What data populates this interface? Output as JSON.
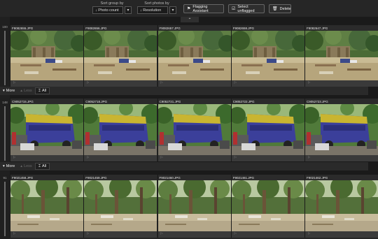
{
  "toolbar": {
    "sort_group_label": "Sort group by",
    "sort_group_value": "↓ Photo count",
    "sort_photos_label": "Sort photos by",
    "sort_photos_value": "↓ Resolution",
    "dropdown_arrow": "▾",
    "flagging_assistant_label": "Flagging Assistant",
    "select_unflagged_label": "Select unflagged",
    "delete_label": "Delete",
    "icons": {
      "flag": "flag-icon",
      "select": "checkbox-icon",
      "delete": "trash-icon",
      "collapse": "chevron-up-icon"
    }
  },
  "collapse_glyph": "⌃",
  "more_bar": {
    "more_label": "More",
    "less_label": "Less",
    "all_label": "All",
    "more_glyph": "▾",
    "less_glyph": "▴",
    "all_glyph": "⌶"
  },
  "groups": [
    {
      "count": "100",
      "files": [
        "F9082655.JPG",
        "F9082656.JPG",
        "F9082657.JPG",
        "F9082658.JPG",
        "F9082647.JPG"
      ],
      "scene": "camp"
    },
    {
      "count": "148",
      "files": [
        "C9052715.JPG",
        "C9052718.JPG",
        "C9052721.JPG",
        "C9052722.JPG",
        "C9052723.JPG"
      ],
      "scene": "bus"
    },
    {
      "count": "91",
      "files": [
        "F9021458.JPG",
        "F9021459.JPG",
        "F9021460.JPG",
        "F9021461.JPG",
        "F9021462.JPG"
      ],
      "scene": "forest"
    }
  ],
  "colors": {
    "background": "#1a1a1a",
    "toolbar": "#262626",
    "bus_blue": "#3b3f9a",
    "bus_yellow": "#c9b530",
    "foliage": "#3d6a2a"
  }
}
